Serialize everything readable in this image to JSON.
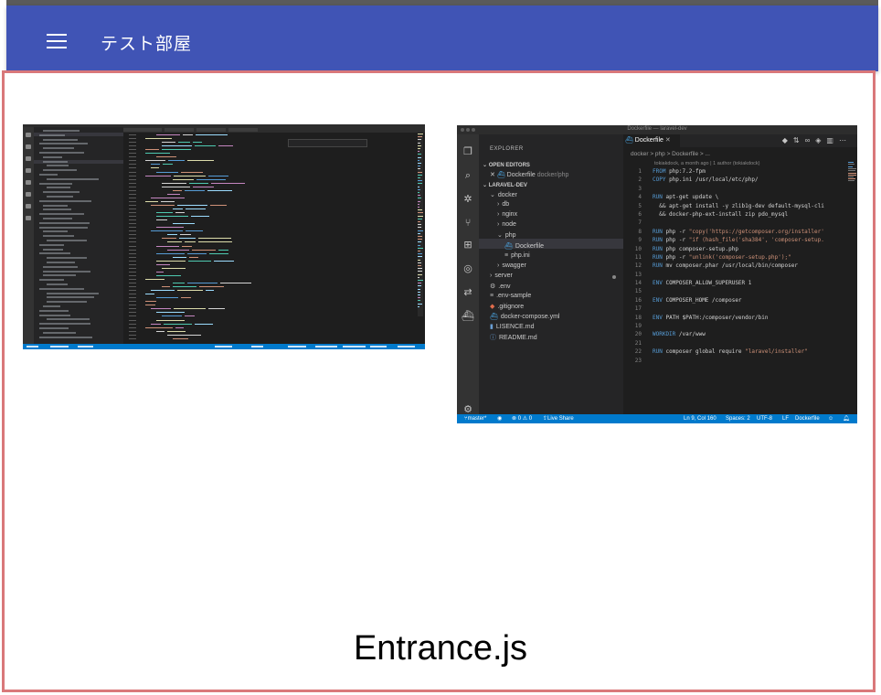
{
  "app": {
    "title": "テスト部屋",
    "menu_icon": "hamburger-menu-icon",
    "accent_color": "#4054b5"
  },
  "room": {
    "caption": "Entrance.js",
    "border_color": "#d9787a"
  },
  "thumbnail_right": {
    "window_title": "Dockerfile — laravel-dev",
    "sidebar": {
      "title": "EXPLORER",
      "open_editors_label": "OPEN EDITORS",
      "open_editor_file": "Dockerfile",
      "open_editor_path": "docker/php",
      "project_label": "LARAVEL-DEV",
      "tree": [
        {
          "label": "docker",
          "icon": "chevron-down-icon"
        },
        {
          "label": "db",
          "icon": "chevron-right-icon"
        },
        {
          "label": "nginx",
          "icon": "chevron-right-icon"
        },
        {
          "label": "node",
          "icon": "chevron-right-icon"
        },
        {
          "label": "php",
          "icon": "chevron-down-icon"
        },
        {
          "label": "Dockerfile",
          "icon": "docker-file-icon"
        },
        {
          "label": "php.ini",
          "icon": "file-icon"
        },
        {
          "label": "swagger",
          "icon": "chevron-right-icon"
        },
        {
          "label": "server",
          "icon": "chevron-right-icon"
        },
        {
          "label": ".env",
          "icon": "gear-file-icon"
        },
        {
          "label": ".env-sample",
          "icon": "file-icon"
        },
        {
          "label": ".gitignore",
          "icon": "git-file-icon"
        },
        {
          "label": "docker-compose.yml",
          "icon": "docker-file-icon"
        },
        {
          "label": "LISENCE.md",
          "icon": "markdown-file-icon"
        },
        {
          "label": "README.md",
          "icon": "info-file-icon"
        }
      ]
    },
    "tab_label": "Dockerfile",
    "breadcrumb": "docker > php > Dockerfile > ...",
    "blame": "tokiakdock, a month ago | 1 author (tokiakdock)",
    "code": [
      {
        "n": "1",
        "kw": "FROM",
        "rest": " php:7.2-fpm"
      },
      {
        "n": "2",
        "kw": "COPY",
        "rest": " php.ini /usr/local/etc/php/"
      },
      {
        "n": "3",
        "kw": "",
        "rest": ""
      },
      {
        "n": "4",
        "kw": "RUN",
        "rest": " apt-get update \\"
      },
      {
        "n": "5",
        "kw": "",
        "rest": "  && apt-get install -y zlib1g-dev default-mysql-cli"
      },
      {
        "n": "6",
        "kw": "",
        "rest": "  && docker-php-ext-install zip pdo_mysql"
      },
      {
        "n": "7",
        "kw": "",
        "rest": ""
      },
      {
        "n": "8",
        "kw": "RUN",
        "rest": " php -r \"copy('https://getcomposer.org/installer'"
      },
      {
        "n": "9",
        "kw": "RUN",
        "rest": " php -r \"if (hash_file('sha384', 'composer-setup."
      },
      {
        "n": "10",
        "kw": "RUN",
        "rest": " php composer-setup.php"
      },
      {
        "n": "11",
        "kw": "RUN",
        "rest": " php -r \"unlink('composer-setup.php');\""
      },
      {
        "n": "12",
        "kw": "RUN",
        "rest": " mv composer.phar /usr/local/bin/composer"
      },
      {
        "n": "13",
        "kw": "",
        "rest": ""
      },
      {
        "n": "14",
        "kw": "ENV",
        "rest": " COMPOSER_ALLOW_SUPERUSER 1"
      },
      {
        "n": "15",
        "kw": "",
        "rest": ""
      },
      {
        "n": "16",
        "kw": "ENV",
        "rest": " COMPOSER_HOME /composer"
      },
      {
        "n": "17",
        "kw": "",
        "rest": ""
      },
      {
        "n": "18",
        "kw": "ENV",
        "rest": " PATH $PATH:/composer/vendor/bin"
      },
      {
        "n": "19",
        "kw": "",
        "rest": ""
      },
      {
        "n": "20",
        "kw": "WORKDIR",
        "rest": " /var/www"
      },
      {
        "n": "21",
        "kw": "",
        "rest": ""
      },
      {
        "n": "22",
        "kw": "RUN",
        "rest": " composer global require \"laravel/installer\""
      },
      {
        "n": "23",
        "kw": "",
        "rest": ""
      }
    ],
    "status": {
      "branch": "master*",
      "problems": "⊗ 0 ⚠ 0",
      "live_share": "Live Share",
      "position": "Ln 9, Col 160",
      "spaces": "Spaces: 2",
      "encoding": "UTF-8",
      "eol": "LF",
      "language": "Dockerfile"
    }
  }
}
